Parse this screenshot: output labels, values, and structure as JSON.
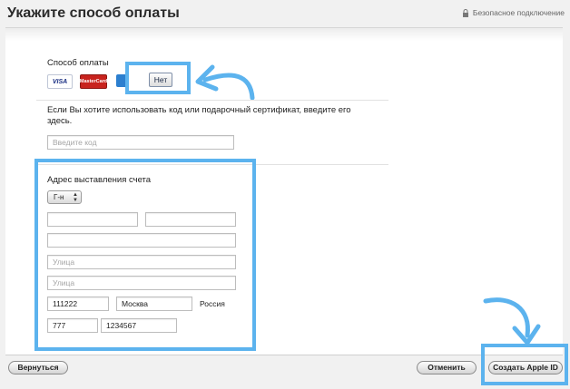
{
  "header": {
    "title": "Укажите способ оплаты",
    "secure_label": "Безопасное подключение",
    "lock_icon": "lock-icon"
  },
  "payment": {
    "label": "Способ оплаты",
    "cards": [
      {
        "name": "visa",
        "text": "VISA"
      },
      {
        "name": "mastercard",
        "text": "MasterCard"
      },
      {
        "name": "amex",
        "text": ""
      }
    ],
    "none_label": "Нет"
  },
  "gift": {
    "description": "Если Вы хотите использовать код или подарочный сертификат, введите его здесь.",
    "placeholder": "Введите код"
  },
  "billing": {
    "title": "Адрес выставления счета",
    "salutation": "Г-н",
    "first_name": "",
    "last_name": "",
    "line3": "",
    "street_placeholder": "Улица",
    "street2_placeholder": "Улица",
    "postal_code": "111222",
    "city": "Москва",
    "country": "Россия",
    "phone_code": "777",
    "phone_number": "1234567"
  },
  "footer": {
    "back_label": "Вернуться",
    "cancel_label": "Отменить",
    "create_label": "Создать Apple ID"
  },
  "colors": {
    "highlight": "#5cb3ee"
  }
}
